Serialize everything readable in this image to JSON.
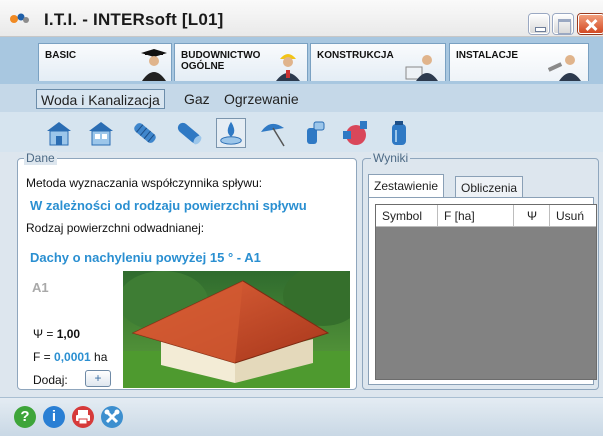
{
  "window": {
    "title": "I.T.I. - INTERsoft [L01]",
    "buttons": {
      "minimize": "minimize",
      "maximize": "maximize",
      "close": "close"
    }
  },
  "main_tabs": [
    {
      "label": "BASIC",
      "active": false
    },
    {
      "label": "BUDOWNICTWO OGÓLNE",
      "active": false
    },
    {
      "label": "KONSTRUKCJA",
      "active": false
    },
    {
      "label": "INSTALACJE",
      "active": true
    }
  ],
  "sub_tabs": [
    {
      "label": "Woda i Kanalizacja",
      "active": true
    },
    {
      "label": "Gaz",
      "active": false
    },
    {
      "label": "Ogrzewanie",
      "active": false
    }
  ],
  "toolbar_icons": [
    {
      "icon": "house-water-icon",
      "selected": false
    },
    {
      "icon": "house-drain-icon",
      "selected": false
    },
    {
      "icon": "corrugated-pipe-icon",
      "selected": false
    },
    {
      "icon": "pipe-icon",
      "selected": false
    },
    {
      "icon": "rain-drop-icon",
      "selected": true
    },
    {
      "icon": "umbrella-icon",
      "selected": false
    },
    {
      "icon": "pipe-fitting-icon",
      "selected": false
    },
    {
      "icon": "pump-icon",
      "selected": false
    },
    {
      "icon": "tank-icon",
      "selected": false
    }
  ],
  "dane": {
    "legend": "Dane",
    "method_label": "Metoda wyznaczania współczynnika spływu:",
    "method_value": "W zależności od rodzaju powierzchni spływu",
    "surface_label": "Rodzaj powierzchni odwadnianej:",
    "surface_value": "Dachy o nachyleniu powyżej 15 ° - A1",
    "code": "A1",
    "psi_label": "Ψ = ",
    "psi_value": "1,00",
    "f_label": "F = ",
    "f_value": "0,0001",
    "f_unit": " ha",
    "add_label": "Dodaj:",
    "add_button": "+"
  },
  "wyniki": {
    "legend": "Wyniki",
    "tabs": [
      {
        "label": "Zestawienie",
        "active": true
      },
      {
        "label": "Obliczenia",
        "active": false
      }
    ],
    "columns": [
      "Symbol",
      "F [ha]",
      "Ψ",
      "Usuń"
    ]
  },
  "bottom_icons": [
    {
      "icon": "help-icon",
      "glyph": "?",
      "color": "#3ea53a"
    },
    {
      "icon": "info-icon",
      "glyph": "i",
      "color": "#2a7fd4"
    },
    {
      "icon": "print-icon",
      "glyph": "",
      "color": "#d63a3a"
    },
    {
      "icon": "tools-icon",
      "glyph": "",
      "color": "#3d8fcf"
    }
  ]
}
